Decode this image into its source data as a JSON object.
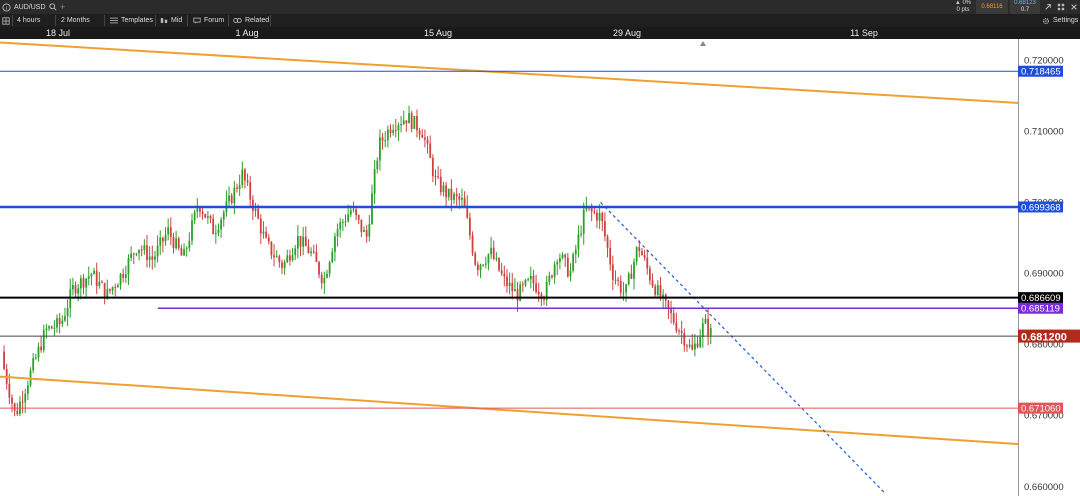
{
  "window": {
    "symbol": "AUD/USD",
    "search_icon": "search-icon",
    "add_tab": "+",
    "change_percent": "0%",
    "change_pts": "0 pts",
    "bid": "0.68116",
    "bid_sub": "",
    "ask": "0.68123",
    "ask_sub": "0.7",
    "colors": {
      "up": "#2aa02a",
      "down": "#d04040",
      "bar": "#2b2b2b"
    }
  },
  "toolbar": {
    "timeframe": "4 hours",
    "range": "2 Months",
    "templates": "Templates",
    "mid": "Mid",
    "forum": "Forum",
    "related": "Related",
    "settings": "Settings"
  },
  "chart_data": {
    "type": "candlestick",
    "title": "",
    "x_ticks": [
      "18 Jul",
      "1 Aug",
      "15 Aug",
      "29 Aug",
      "11 Sep"
    ],
    "y_ticks": [
      "0.720000",
      "0.710000",
      "0.700000",
      "0.690000",
      "0.680000",
      "0.670000",
      "0.660000"
    ],
    "ylim": [
      0.6587,
      0.723
    ],
    "grid": false,
    "horizontal_lines": [
      {
        "value": 0.718465,
        "label": "0.718465",
        "color": "#1e4ed8",
        "width": 1
      },
      {
        "value": 0.699368,
        "label": "0.699368",
        "color": "#1e4ed8",
        "width": 2.5
      },
      {
        "value": 0.686609,
        "label": "0.686609",
        "color": "#000000",
        "width": 2
      },
      {
        "value": 0.685119,
        "label": "0.685119",
        "color": "#7b2cd8",
        "width": 1.5,
        "x_start": 0.155
      },
      {
        "value": 0.6812,
        "label": "0.681200",
        "color": "#444444",
        "width": 1
      },
      {
        "value": 0.67106,
        "label": "0.671060",
        "color": "#e05555",
        "width": 1
      }
    ],
    "trendlines": [
      {
        "from": [
          0.0,
          0.7225
        ],
        "to": [
          1.0,
          0.714
        ],
        "color": "#f0a030",
        "style": "solid"
      },
      {
        "from": [
          0.0,
          0.6755
        ],
        "to": [
          1.0,
          0.666
        ],
        "color": "#f0a030",
        "style": "solid"
      },
      {
        "from": [
          0.59,
          0.7
        ],
        "to": [
          0.87,
          0.659
        ],
        "color": "#1e5bd8",
        "style": "dashed"
      }
    ],
    "current_price": "0.681200",
    "price_path": [
      [
        0.0,
        0.679
      ],
      [
        0.015,
        0.67
      ],
      [
        0.03,
        0.676
      ],
      [
        0.045,
        0.682
      ],
      [
        0.06,
        0.683
      ],
      [
        0.072,
        0.688
      ],
      [
        0.09,
        0.69
      ],
      [
        0.105,
        0.687
      ],
      [
        0.12,
        0.69
      ],
      [
        0.135,
        0.694
      ],
      [
        0.15,
        0.692
      ],
      [
        0.165,
        0.696
      ],
      [
        0.18,
        0.692
      ],
      [
        0.195,
        0.7
      ],
      [
        0.21,
        0.696
      ],
      [
        0.225,
        0.7
      ],
      [
        0.238,
        0.704
      ],
      [
        0.25,
        0.699
      ],
      [
        0.262,
        0.694
      ],
      [
        0.278,
        0.691
      ],
      [
        0.292,
        0.695
      ],
      [
        0.305,
        0.693
      ],
      [
        0.318,
        0.689
      ],
      [
        0.33,
        0.696
      ],
      [
        0.345,
        0.699
      ],
      [
        0.36,
        0.695
      ],
      [
        0.372,
        0.708
      ],
      [
        0.385,
        0.711
      ],
      [
        0.4,
        0.712
      ],
      [
        0.415,
        0.71
      ],
      [
        0.428,
        0.703
      ],
      [
        0.44,
        0.701
      ],
      [
        0.455,
        0.7
      ],
      [
        0.468,
        0.691
      ],
      [
        0.482,
        0.693
      ],
      [
        0.495,
        0.689
      ],
      [
        0.508,
        0.687
      ],
      [
        0.522,
        0.689
      ],
      [
        0.535,
        0.687
      ],
      [
        0.548,
        0.693
      ],
      [
        0.56,
        0.69
      ],
      [
        0.575,
        0.699
      ],
      [
        0.59,
        0.698
      ],
      [
        0.602,
        0.69
      ],
      [
        0.614,
        0.687
      ],
      [
        0.627,
        0.694
      ],
      [
        0.64,
        0.689
      ],
      [
        0.655,
        0.685
      ],
      [
        0.668,
        0.682
      ],
      [
        0.68,
        0.679
      ],
      [
        0.692,
        0.683
      ],
      [
        0.7,
        0.6812
      ]
    ]
  }
}
